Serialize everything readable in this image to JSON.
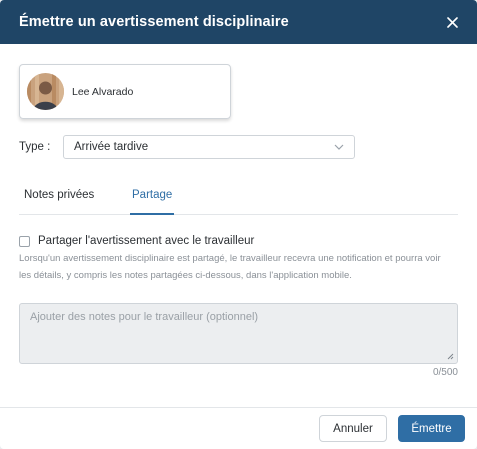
{
  "dialog": {
    "title": "Émettre un avertissement disciplinaire",
    "close_icon": "close-icon"
  },
  "employee": {
    "name": "Lee Alvarado",
    "avatar_icon": "avatar-photo"
  },
  "type_field": {
    "label": "Type :",
    "selected_value": "Arrivée tardive",
    "icon": "chevron-down-icon"
  },
  "tabs": [
    {
      "label": "Notes privées",
      "active": false
    },
    {
      "label": "Partage",
      "active": true
    }
  ],
  "share": {
    "checkbox_label": "Partager l'avertissement avec le travailleur",
    "checked": false,
    "helper_text": "Lorsqu'un avertissement disciplinaire est partagé, le travailleur recevra une notification et pourra voir les détails, y compris les notes partagées ci-dessous, dans l'application mobile."
  },
  "notes": {
    "placeholder": "Ajouter des notes pour le travailleur (optionnel)",
    "value": "",
    "counter": "0/500"
  },
  "footer": {
    "cancel_label": "Annuler",
    "submit_label": "Émettre"
  },
  "colors": {
    "header_bg": "#1f4566",
    "accent": "#2f6ea5"
  }
}
